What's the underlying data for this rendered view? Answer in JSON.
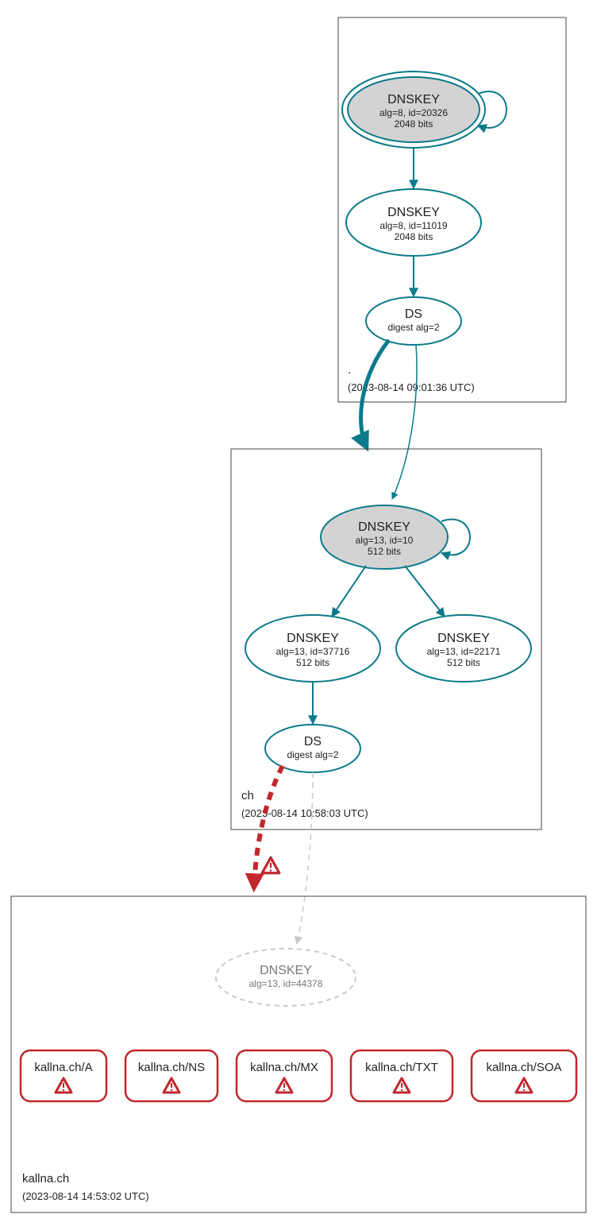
{
  "chart_data": {
    "type": "graph",
    "zones": [
      {
        "name": ".",
        "timestamp": "(2023-08-14 09:01:36 UTC)"
      },
      {
        "name": "ch",
        "timestamp": "(2023-08-14 10:58:03 UTC)"
      },
      {
        "name": "kallna.ch",
        "timestamp": "(2023-08-14 14:53:02 UTC)"
      }
    ],
    "nodes": {
      "root_ksk": {
        "title": "DNSKEY",
        "l1": "alg=8, id=20326",
        "l2": "2048 bits"
      },
      "root_zsk": {
        "title": "DNSKEY",
        "l1": "alg=8, id=11019",
        "l2": "2048 bits"
      },
      "root_ds": {
        "title": "DS",
        "l1": "digest alg=2"
      },
      "ch_ksk": {
        "title": "DNSKEY",
        "l1": "alg=13, id=10",
        "l2": "512 bits"
      },
      "ch_zsk1": {
        "title": "DNSKEY",
        "l1": "alg=13, id=37716",
        "l2": "512 bits"
      },
      "ch_zsk2": {
        "title": "DNSKEY",
        "l1": "alg=13, id=22171",
        "l2": "512 bits"
      },
      "ch_ds": {
        "title": "DS",
        "l1": "digest alg=2"
      },
      "k_dnskey": {
        "title": "DNSKEY",
        "l1": "alg=13, id=44378"
      }
    },
    "rrsets": [
      "kallna.ch/A",
      "kallna.ch/NS",
      "kallna.ch/MX",
      "kallna.ch/TXT",
      "kallna.ch/SOA"
    ]
  }
}
